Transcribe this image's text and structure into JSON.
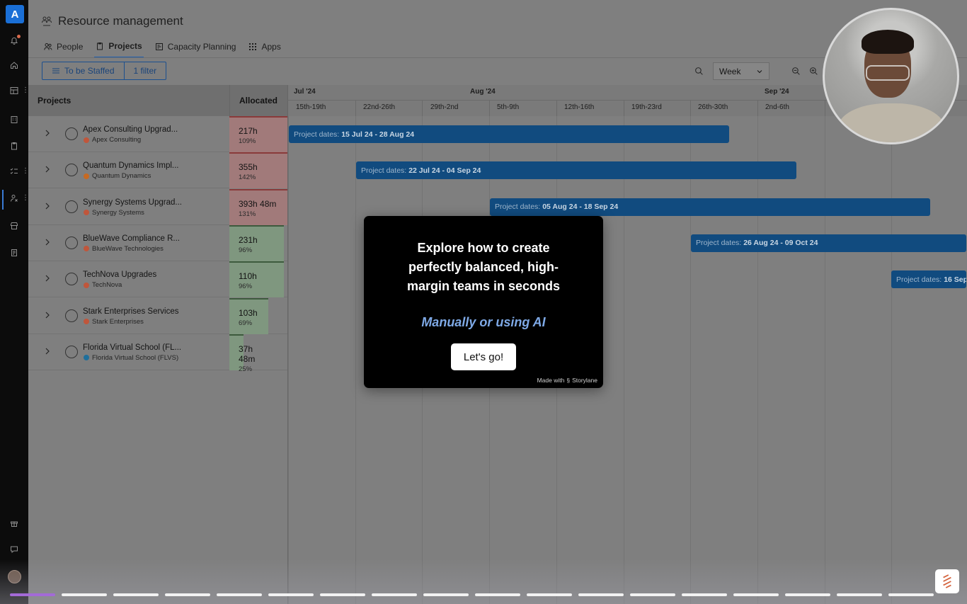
{
  "app": {
    "title": "Resource management"
  },
  "tabs": [
    {
      "label": "People",
      "icon": "people-icon"
    },
    {
      "label": "Projects",
      "icon": "clipboard-icon",
      "active": true
    },
    {
      "label": "Capacity Planning",
      "icon": "capacity-icon"
    },
    {
      "label": "Apps",
      "icon": "grid-icon"
    }
  ],
  "filters": {
    "view": "To be Staffed",
    "count": "1 filter"
  },
  "toolbar": {
    "scale": "Week"
  },
  "grid": {
    "projects_header": "Projects",
    "allocated_header": "Allocated",
    "months": [
      "Jul '24",
      "Aug '24",
      "Sep '24"
    ],
    "weeks": [
      "15th-19th",
      "22nd-26th",
      "29th-2nd",
      "5th-9th",
      "12th-16th",
      "19th-23rd",
      "26th-30th",
      "2nd-6th"
    ],
    "rows": [
      {
        "name": "Apex Consulting Upgrad...",
        "client": "Apex Consulting",
        "client_color": "#c0563b",
        "hours": "217h",
        "percent": "109%",
        "status": "over",
        "utilization": 1.09,
        "bar_label": "Project dates:",
        "bar_dates": "15 Jul 24 - 28 Aug 24"
      },
      {
        "name": "Quantum Dynamics Impl...",
        "client": "Quantum Dynamics",
        "client_color": "#c76a22",
        "hours": "355h",
        "percent": "142%",
        "status": "over",
        "utilization": 1.42,
        "bar_label": "Project dates:",
        "bar_dates": "22 Jul 24 - 04 Sep 24"
      },
      {
        "name": "Synergy Systems Upgrad...",
        "client": "Synergy Systems",
        "client_color": "#c0563b",
        "hours": "393h 48m",
        "percent": "131%",
        "status": "over",
        "utilization": 1.31,
        "bar_label": "Project dates:",
        "bar_dates": "05 Aug 24 - 18 Sep 24"
      },
      {
        "name": "BlueWave Compliance R...",
        "client": "BlueWave Technologies",
        "client_color": "#c0563b",
        "hours": "231h",
        "percent": "96%",
        "status": "ok",
        "utilization": 0.96,
        "bar_label": "Project dates:",
        "bar_dates": "26 Aug 24 - 09 Oct 24"
      },
      {
        "name": "TechNova Upgrades",
        "client": "TechNova",
        "client_color": "#c0563b",
        "hours": "110h",
        "percent": "96%",
        "status": "ok",
        "utilization": 0.96,
        "bar_label": "Project dates:",
        "bar_dates": "16 Sep"
      },
      {
        "name": "Stark Enterprises Services",
        "client": "Stark Enterprises",
        "client_color": "#c0563b",
        "hours": "103h",
        "percent": "69%",
        "status": "ok",
        "utilization": 0.69,
        "bar_label": "",
        "bar_dates": ""
      },
      {
        "name": "Florida Virtual School (FL...",
        "client": "Florida Virtual School (FLVS)",
        "client_color": "#1f6f9c",
        "hours": "37h 48m",
        "percent": "25%",
        "status": "ok",
        "utilization": 0.25,
        "bar_label": "",
        "bar_dates": ""
      }
    ]
  },
  "modal": {
    "heading_line1": "Explore how to create",
    "heading_line2": "perfectly balanced, high-",
    "heading_line3": "margin teams in seconds",
    "subheading": "Manually or using AI",
    "cta": "Let's go!",
    "made_with": "Made with",
    "brand": "Storylane"
  },
  "progress": {
    "total_steps": 18,
    "current_step": 1
  },
  "colors": {
    "accent": "#1a6fd6",
    "bar": "#114b7f",
    "modal_sub": "#7ea9e6",
    "progress_active": "#a36ad7"
  }
}
